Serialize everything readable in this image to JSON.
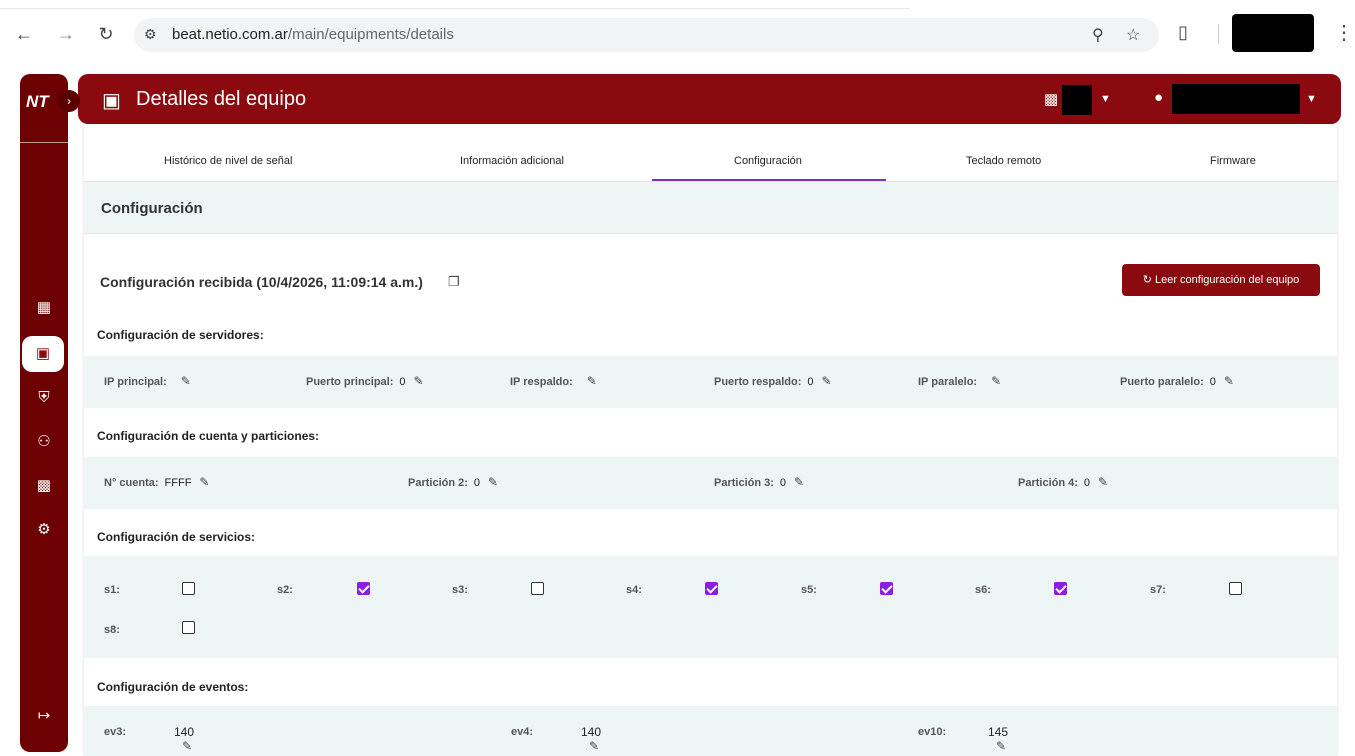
{
  "browser": {
    "url_host": "beat.netio.com.ar",
    "url_path": "/main/equipments/details"
  },
  "header": {
    "title": "Detalles del equipo"
  },
  "sidebar": {
    "logo_text": "NT"
  },
  "tabs": [
    {
      "label": "Histórico de nivel de señal",
      "active": false
    },
    {
      "label": "Información adicional",
      "active": false
    },
    {
      "label": "Configuración",
      "active": true
    },
    {
      "label": "Teclado remoto",
      "active": false
    },
    {
      "label": "Firmware",
      "active": false
    }
  ],
  "section": {
    "title": "Configuración"
  },
  "received": {
    "title": "Configuración recibida (10/4/2026, 11:09:14 a.m.)",
    "read_button": "Leer configuración del equipo"
  },
  "servers": {
    "title": "Configuración de servidores:",
    "fields": [
      {
        "label": "IP principal:",
        "value": ""
      },
      {
        "label": "Puerto principal:",
        "value": "0"
      },
      {
        "label": "IP respaldo:",
        "value": ""
      },
      {
        "label": "Puerto respaldo:",
        "value": "0"
      },
      {
        "label": "IP paralelo:",
        "value": ""
      },
      {
        "label": "Puerto paralelo:",
        "value": "0"
      }
    ]
  },
  "account": {
    "title": "Configuración de cuenta y particiones:",
    "fields": [
      {
        "label": "N° cuenta:",
        "value": "FFFF"
      },
      {
        "label": "Partición 2:",
        "value": "0"
      },
      {
        "label": "Partición 3:",
        "value": "0"
      },
      {
        "label": "Partición 4:",
        "value": "0"
      }
    ]
  },
  "services": {
    "title": "Configuración de servicios:",
    "items": [
      {
        "label": "s1:",
        "checked": false
      },
      {
        "label": "s2:",
        "checked": true
      },
      {
        "label": "s3:",
        "checked": false
      },
      {
        "label": "s4:",
        "checked": true
      },
      {
        "label": "s5:",
        "checked": true
      },
      {
        "label": "s6:",
        "checked": true
      },
      {
        "label": "s7:",
        "checked": false
      },
      {
        "label": "s8:",
        "checked": false
      }
    ]
  },
  "events": {
    "title": "Configuración de eventos:",
    "fields": [
      {
        "label": "ev3:",
        "value": "140"
      },
      {
        "label": "ev4:",
        "value": "140"
      },
      {
        "label": "ev10:",
        "value": "145"
      }
    ]
  },
  "colors": {
    "brand": "#8a0a0f",
    "sidebar": "#6d0000",
    "accent": "#8b1ee0",
    "band": "#eef5f5"
  }
}
